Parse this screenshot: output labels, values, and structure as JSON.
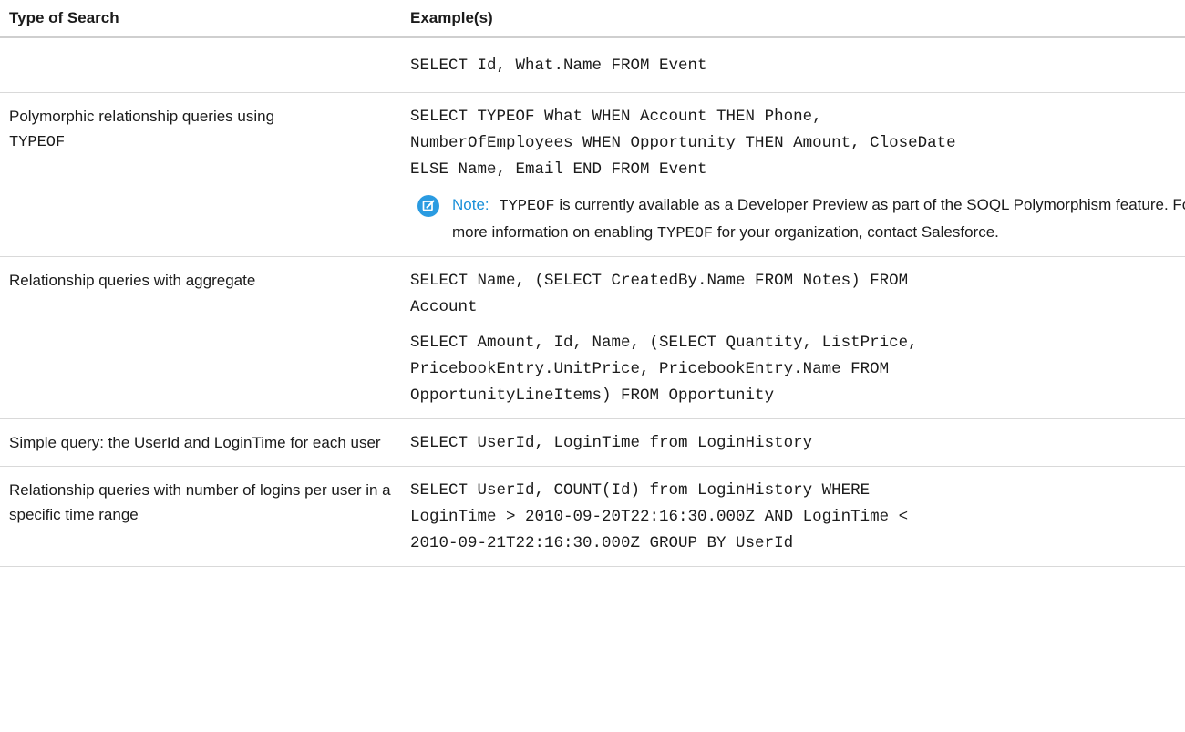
{
  "table": {
    "headers": {
      "type": "Type of Search",
      "example": "Example(s)"
    },
    "rows": [
      {
        "type_text": "",
        "type_code": "",
        "examples": [
          "SELECT Id, What.Name FROM Event"
        ]
      },
      {
        "type_text": "Polymorphic relationship queries using",
        "type_code": "TYPEOF",
        "examples": [
          "SELECT TYPEOF What WHEN Account THEN Phone,\nNumberOfEmployees WHEN Opportunity THEN Amount, CloseDate\nELSE Name, Email END FROM Event"
        ],
        "note": {
          "label": "Note:",
          "code1": "TYPEOF",
          "text1": "is currently available as a Developer Preview as part of the SOQL Polymorphism feature. For more information on enabling",
          "code2": "TYPEOF",
          "text2": "for your organization, contact Salesforce."
        }
      },
      {
        "type_text": "Relationship queries with aggregate",
        "type_code": "",
        "examples": [
          "SELECT Name, (SELECT CreatedBy.Name FROM Notes) FROM\nAccount",
          "SELECT Amount, Id, Name, (SELECT Quantity, ListPrice,\nPricebookEntry.UnitPrice, PricebookEntry.Name FROM\nOpportunityLineItems) FROM Opportunity"
        ]
      },
      {
        "type_text": "Simple query: the UserId and LoginTime for each user",
        "type_code": "",
        "examples": [
          "SELECT UserId, LoginTime from LoginHistory"
        ]
      },
      {
        "type_text": "Relationship queries with number of logins per user in a specific time range",
        "type_code": "",
        "examples": [
          "SELECT UserId, COUNT(Id) from LoginHistory WHERE\nLoginTime > 2010-09-20T22:16:30.000Z AND LoginTime <\n2010-09-21T22:16:30.000Z GROUP BY UserId"
        ]
      }
    ]
  },
  "colors": {
    "note_accent": "#1b90d9",
    "note_icon": "#2a9be1",
    "rule": "#d9d9d9"
  },
  "icons": {
    "note": "edit-note-icon"
  }
}
